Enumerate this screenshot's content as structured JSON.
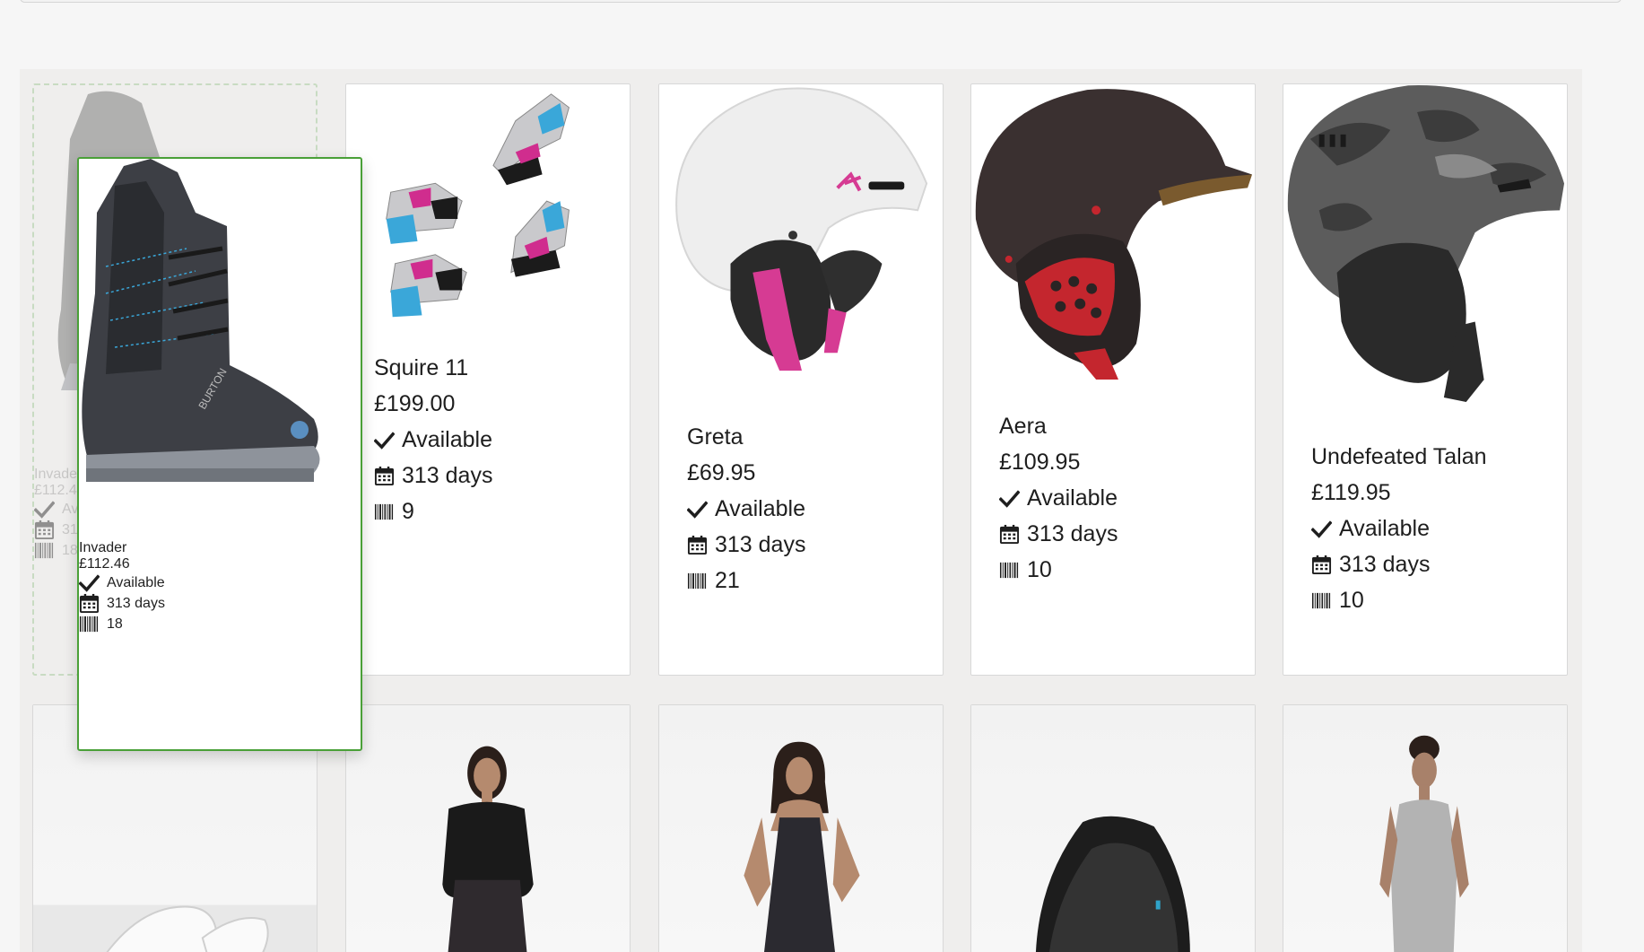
{
  "icons": {
    "check": "check-icon",
    "calendar": "calendar-icon",
    "barcode": "barcode-icon"
  },
  "colors": {
    "drag_border": "#4aa038",
    "placeholder_border": "#9bc58f",
    "panel_bg": "#efeeed"
  },
  "dragging": {
    "name": "Invader",
    "price": "£112.46",
    "status": "Available",
    "age": "313 days",
    "stock": "18"
  },
  "placeholder": {
    "name": "Invader",
    "price": "£112.46",
    "status": "Available",
    "age": "313 days",
    "stock": "18"
  },
  "products": [
    {
      "name": "Squire 11",
      "price": "£199.00",
      "status": "Available",
      "age": "313 days",
      "stock": "9"
    },
    {
      "name": "Greta",
      "price": "£69.95",
      "status": "Available",
      "age": "313 days",
      "stock": "21"
    },
    {
      "name": "Aera",
      "price": "£109.95",
      "status": "Available",
      "age": "313 days",
      "stock": "10"
    },
    {
      "name": "Undefeated Talan",
      "price": "£119.95",
      "status": "Available",
      "age": "313 days",
      "stock": "10"
    }
  ]
}
